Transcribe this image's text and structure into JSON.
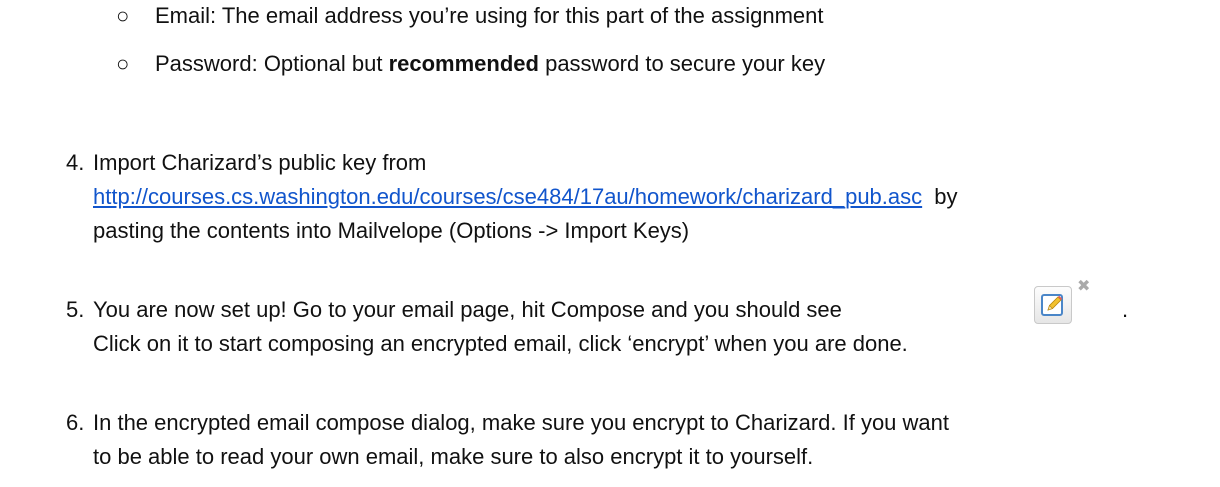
{
  "sub_bullets": [
    {
      "bullet": "○",
      "text": "Email: The email address you’re using for this part of the assignment"
    },
    {
      "bullet": "○",
      "prefix": "Password: Optional but ",
      "bold": "recommended",
      "suffix": " password to secure your key"
    }
  ],
  "steps": [
    {
      "number": "4.",
      "line1": "Import Charizard’s public key from",
      "link": "http://courses.cs.washington.edu/courses/cse484/17au/homework/charizard_pub.asc",
      "link_after": " by",
      "line3": "pasting the contents into Mailvelope (Options -> Import Keys)"
    },
    {
      "number": "5.",
      "line1": "You are now set up! Go to your email page, hit Compose and you should see",
      "line1_end": ".",
      "line2": "Click on it to start composing an encrypted email, click ‘encrypt’ when you are done."
    },
    {
      "number": "6.",
      "line1": "In the encrypted email compose dialog, make sure you encrypt to Charizard. If you want",
      "line2": "to be able to read your own email, make sure to also encrypt it to yourself."
    }
  ],
  "icons": {
    "mailvelope_compose": "pencil-edit-icon",
    "mailvelope_close": "close-icon"
  }
}
